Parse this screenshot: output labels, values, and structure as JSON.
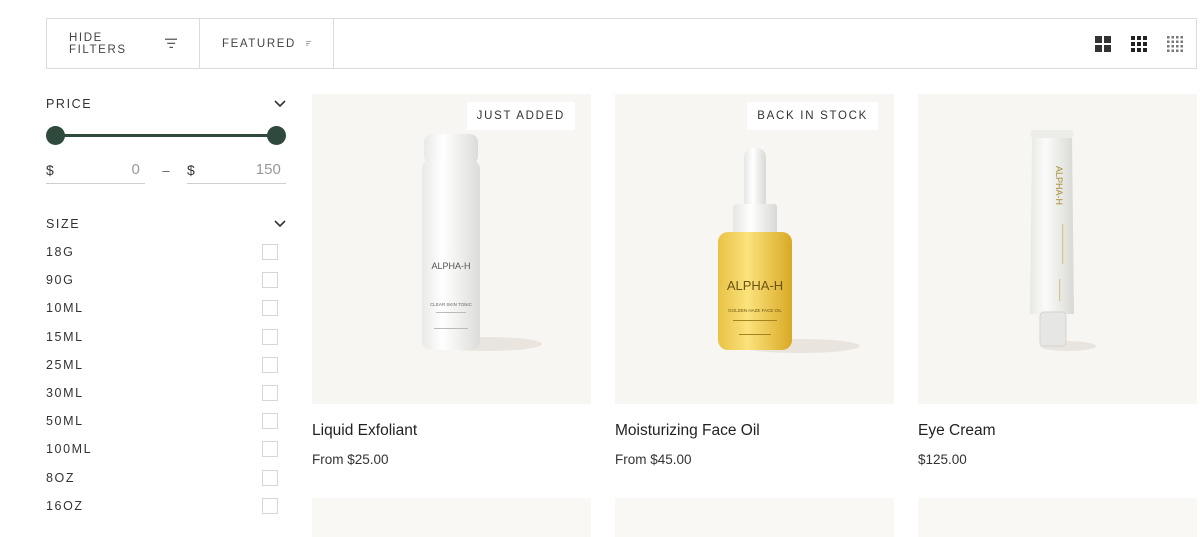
{
  "toolbar": {
    "hide_filters": "HIDE FILTERS",
    "featured": "FEATURED",
    "view_icons": [
      "grid-large-icon",
      "grid-medium-icon",
      "grid-small-icon"
    ]
  },
  "filters": {
    "price": {
      "title": "PRICE",
      "currency": "$",
      "min": "0",
      "max": "150",
      "range_min_fraction": 0,
      "range_max_fraction": 1,
      "separator": "–"
    },
    "size": {
      "title": "SIZE",
      "options": [
        "18G",
        "90G",
        "10ML",
        "15ML",
        "25ML",
        "30ML",
        "50ML",
        "100ML",
        "8OZ",
        "16OZ"
      ]
    }
  },
  "products": [
    {
      "name": "Liquid Exfoliant",
      "price": "From $25.00",
      "badge": "JUST ADDED",
      "brand": "ALPHA-H",
      "label": "CLEAR SKIN TONIC"
    },
    {
      "name": "Moisturizing Face Oil",
      "price": "From $45.00",
      "badge": "BACK IN STOCK",
      "brand": "ALPHA-H",
      "label": "GOLDEN HAZE FACE OIL"
    },
    {
      "name": "Eye Cream",
      "price": "$125.00",
      "badge": "",
      "brand": "ALPHA-H",
      "label": ""
    }
  ],
  "colors": {
    "accent": "#2f4a3c",
    "card_bg": "#f8f6f2",
    "border": "#dcdcdc"
  }
}
